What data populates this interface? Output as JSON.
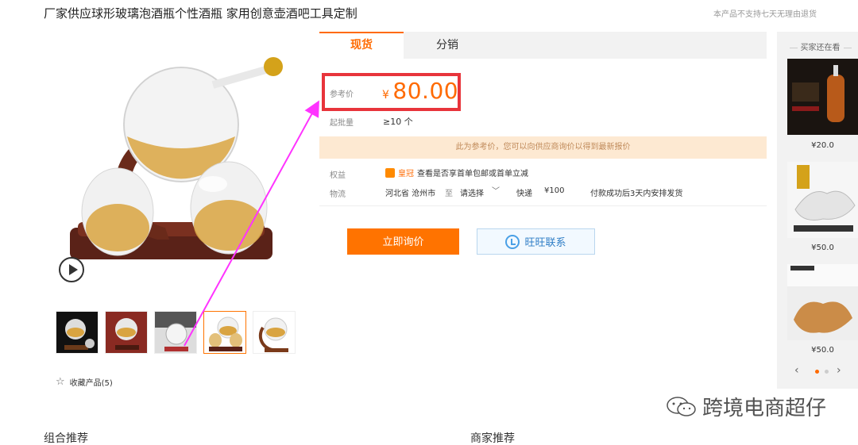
{
  "product": {
    "title": "厂家供应球形玻璃泡酒瓶个性酒瓶 家用创意壶酒吧工具定制",
    "notice": "本产品不支持七天无理由退货"
  },
  "gallery": {
    "favorite_label": "收藏产品(5)"
  },
  "tabs": [
    {
      "label": "现货"
    },
    {
      "label": "分销"
    }
  ],
  "price": {
    "label": "参考价",
    "currency": "¥",
    "value": "80.00"
  },
  "moq": {
    "label": "起批量",
    "value": "≥10 个"
  },
  "reference_notice": "此为参考价，您可以向供应商询价以得到最新报价",
  "benefits": {
    "label": "权益",
    "badge": "皇冠",
    "text": "查看是否享首单包邮或首单立减"
  },
  "logistics": {
    "label": "物流",
    "origin": "河北省 沧州市",
    "to": "至",
    "destination": "请选择",
    "method": "快递",
    "fee": "¥100",
    "shipping": "付款成功后3天内安排发货"
  },
  "actions": {
    "inquiry": "立即询价",
    "wangwang": "旺旺联系"
  },
  "rail": {
    "title": "买家还在看",
    "items": [
      {
        "price": "¥20.0"
      },
      {
        "price": "¥50.0"
      },
      {
        "price": "¥50.0"
      }
    ],
    "prev_icon": "‹",
    "next_icon": "›"
  },
  "watermark": "跨境电商超仔",
  "sections": {
    "combo": "组合推荐",
    "merchant": "商家推荐"
  },
  "colors": {
    "accent": "#ff6a00",
    "highlight": "#e8343b",
    "annotation": "#ff33ff"
  }
}
